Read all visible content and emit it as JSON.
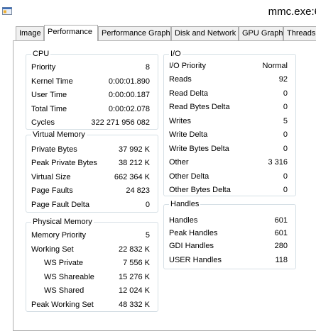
{
  "window": {
    "title": "mmc.exe:6"
  },
  "tabs": [
    "Image",
    "Performance",
    "Performance Graph",
    "Disk and Network",
    "GPU Graph",
    "Threads"
  ],
  "active_tab": "Performance",
  "groups": {
    "cpu": {
      "title": "CPU",
      "rows": [
        {
          "label": "Priority",
          "value": "8"
        },
        {
          "label": "Kernel Time",
          "value": "0:00:01.890"
        },
        {
          "label": "User Time",
          "value": "0:00:00.187"
        },
        {
          "label": "Total Time",
          "value": "0:00:02.078"
        },
        {
          "label": "Cycles",
          "value": "322 271 956 082"
        }
      ]
    },
    "virtual_memory": {
      "title": "Virtual Memory",
      "rows": [
        {
          "label": "Private Bytes",
          "value": "37 992 K"
        },
        {
          "label": "Peak Private Bytes",
          "value": "38 212 K"
        },
        {
          "label": "Virtual Size",
          "value": "662 364 K"
        },
        {
          "label": "Page Faults",
          "value": "24 823"
        },
        {
          "label": "Page Fault Delta",
          "value": "0"
        }
      ]
    },
    "physical_memory": {
      "title": "Physical Memory",
      "rows": [
        {
          "label": "Memory Priority",
          "value": "5"
        },
        {
          "label": "Working Set",
          "value": "22 832 K"
        },
        {
          "label": "WS Private",
          "value": "7 556 K"
        },
        {
          "label": "WS Shareable",
          "value": "15 276 K"
        },
        {
          "label": "WS Shared",
          "value": "12 024 K"
        },
        {
          "label": "Peak Working Set",
          "value": "48 332 K"
        }
      ]
    },
    "io": {
      "title": "I/O",
      "rows": [
        {
          "label": "I/O Priority",
          "value": "Normal"
        },
        {
          "label": "Reads",
          "value": "92"
        },
        {
          "label": "Read Delta",
          "value": "0"
        },
        {
          "label": "Read Bytes Delta",
          "value": "0"
        },
        {
          "label": "Writes",
          "value": "5"
        },
        {
          "label": "Write Delta",
          "value": "0"
        },
        {
          "label": "Write Bytes Delta",
          "value": "0"
        },
        {
          "label": "Other",
          "value": "3 316"
        },
        {
          "label": "Other Delta",
          "value": "0"
        },
        {
          "label": "Other Bytes Delta",
          "value": "0"
        }
      ]
    },
    "handles": {
      "title": "Handles",
      "rows": [
        {
          "label": "Handles",
          "value": "601"
        },
        {
          "label": "Peak Handles",
          "value": "601"
        },
        {
          "label": "GDI Handles",
          "value": "280"
        },
        {
          "label": "USER Handles",
          "value": "118"
        }
      ]
    }
  }
}
